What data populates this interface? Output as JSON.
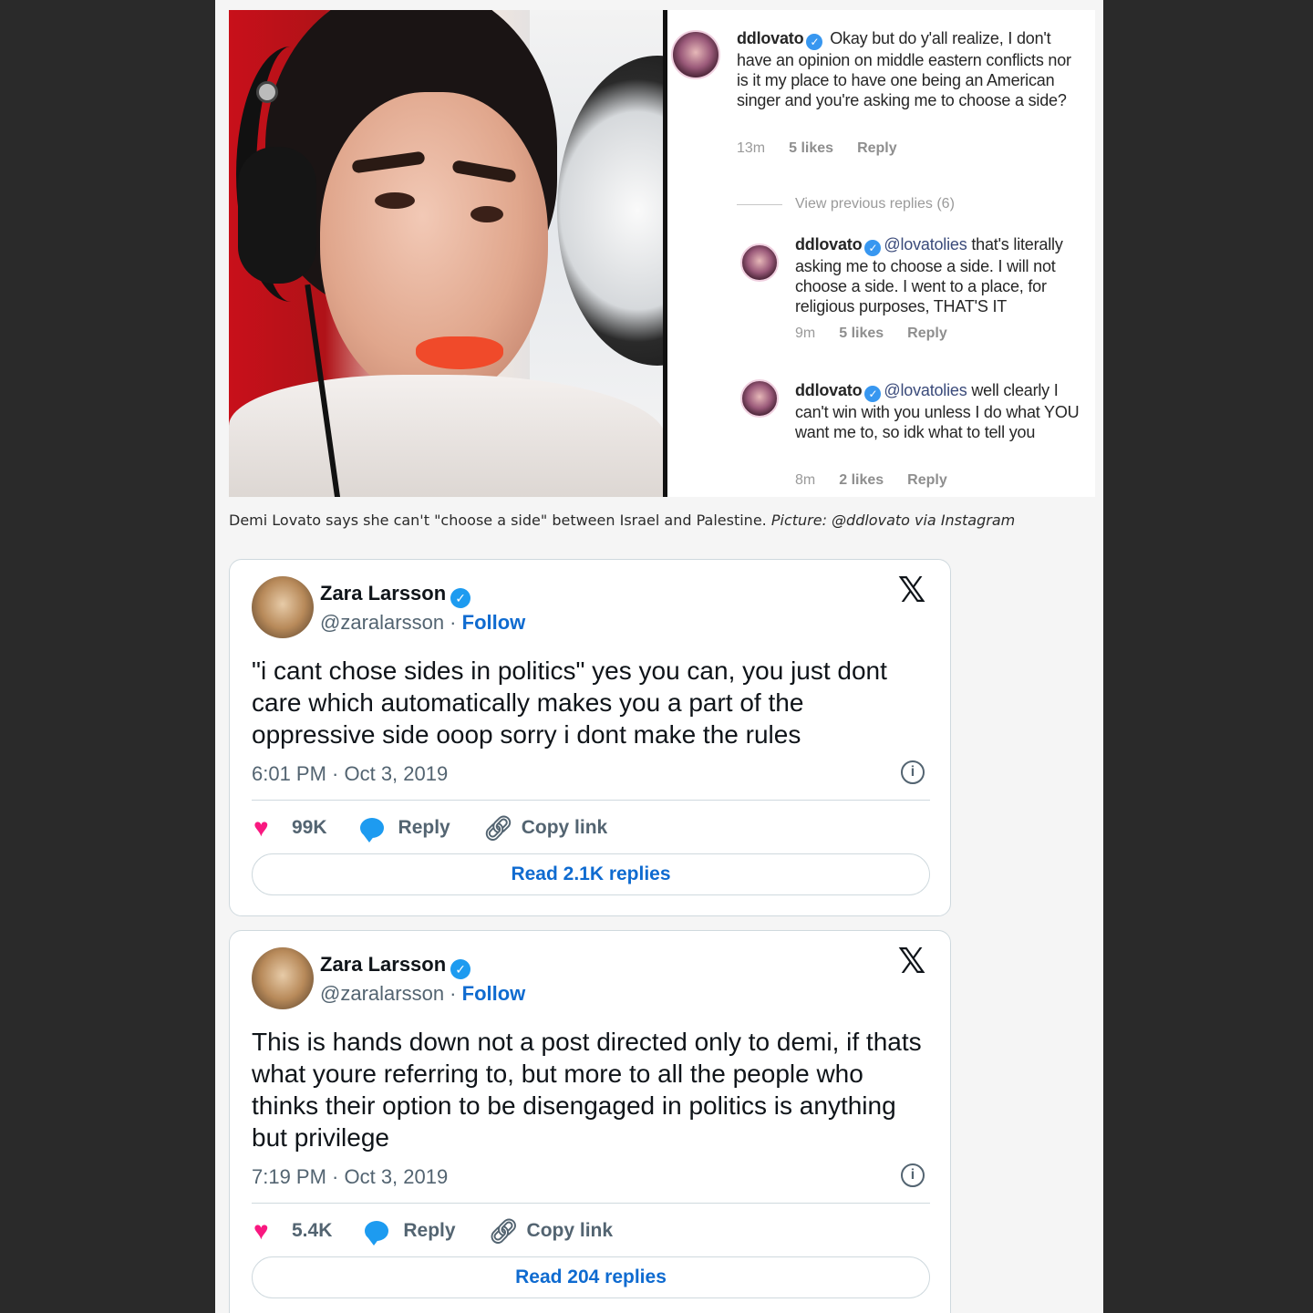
{
  "instagram": {
    "comments": [
      {
        "user": "ddlovato",
        "mention": "",
        "text": "Okay but do y'all realize, I don't have an opinion on middle eastern conflicts nor is it my place to have one being an American singer and you're asking me to choose a side?",
        "time": "13m",
        "likes": "5 likes",
        "reply": "Reply"
      },
      {
        "user": "ddlovato",
        "mention": "@lovatolies",
        "text": "that's literally asking me to choose a side. I will not choose a side. I went to a place, for religious purposes, THAT'S IT",
        "time": "9m",
        "likes": "5 likes",
        "reply": "Reply"
      },
      {
        "user": "ddlovato",
        "mention": "@lovatolies",
        "text": "well clearly I can't win with you unless I do what YOU want me to, so idk what to tell you",
        "time": "8m",
        "likes": "2 likes",
        "reply": "Reply"
      }
    ],
    "view_previous": "View previous replies (6)"
  },
  "caption": {
    "text": "Demi Lovato says she can't \"choose a side\" between Israel and Palestine.",
    "credit": "Picture: @ddlovato via Instagram"
  },
  "tweets": [
    {
      "name": "Zara Larsson",
      "handle": "@zaralarsson",
      "separator": " · ",
      "follow": "Follow",
      "text": "\"i cant chose sides in politics\" yes you can, you just dont care which automatically makes you a part of the oppressive side ooop sorry i dont make the rules",
      "timestamp": "6:01 PM · Oct 3, 2019",
      "likes": "99K",
      "reply": "Reply",
      "copy_link": "Copy link",
      "read_replies": "Read 2.1K replies"
    },
    {
      "name": "Zara Larsson",
      "handle": "@zaralarsson",
      "separator": " · ",
      "follow": "Follow",
      "text": "This is hands down not a post directed only to demi, if thats what youre referring to, but more to all the people who thinks their option to be disengaged in politics is anything but privilege",
      "timestamp": "7:19 PM · Oct 3, 2019",
      "likes": "5.4K",
      "reply": "Reply",
      "copy_link": "Copy link",
      "read_replies": "Read 204 replies"
    }
  ],
  "icons": {
    "verified": "verified-badge-icon",
    "x_logo": "x-logo-icon",
    "info": "info-icon",
    "heart": "heart-icon",
    "reply": "reply-bubble-icon",
    "link": "link-icon"
  },
  "colors": {
    "page_bg": "#2a2a2a",
    "content_bg": "#f5f5f5",
    "twitter_blue": "#1d9bf0",
    "follow_blue": "#0f6bd0",
    "heart_pink": "#f91880"
  }
}
